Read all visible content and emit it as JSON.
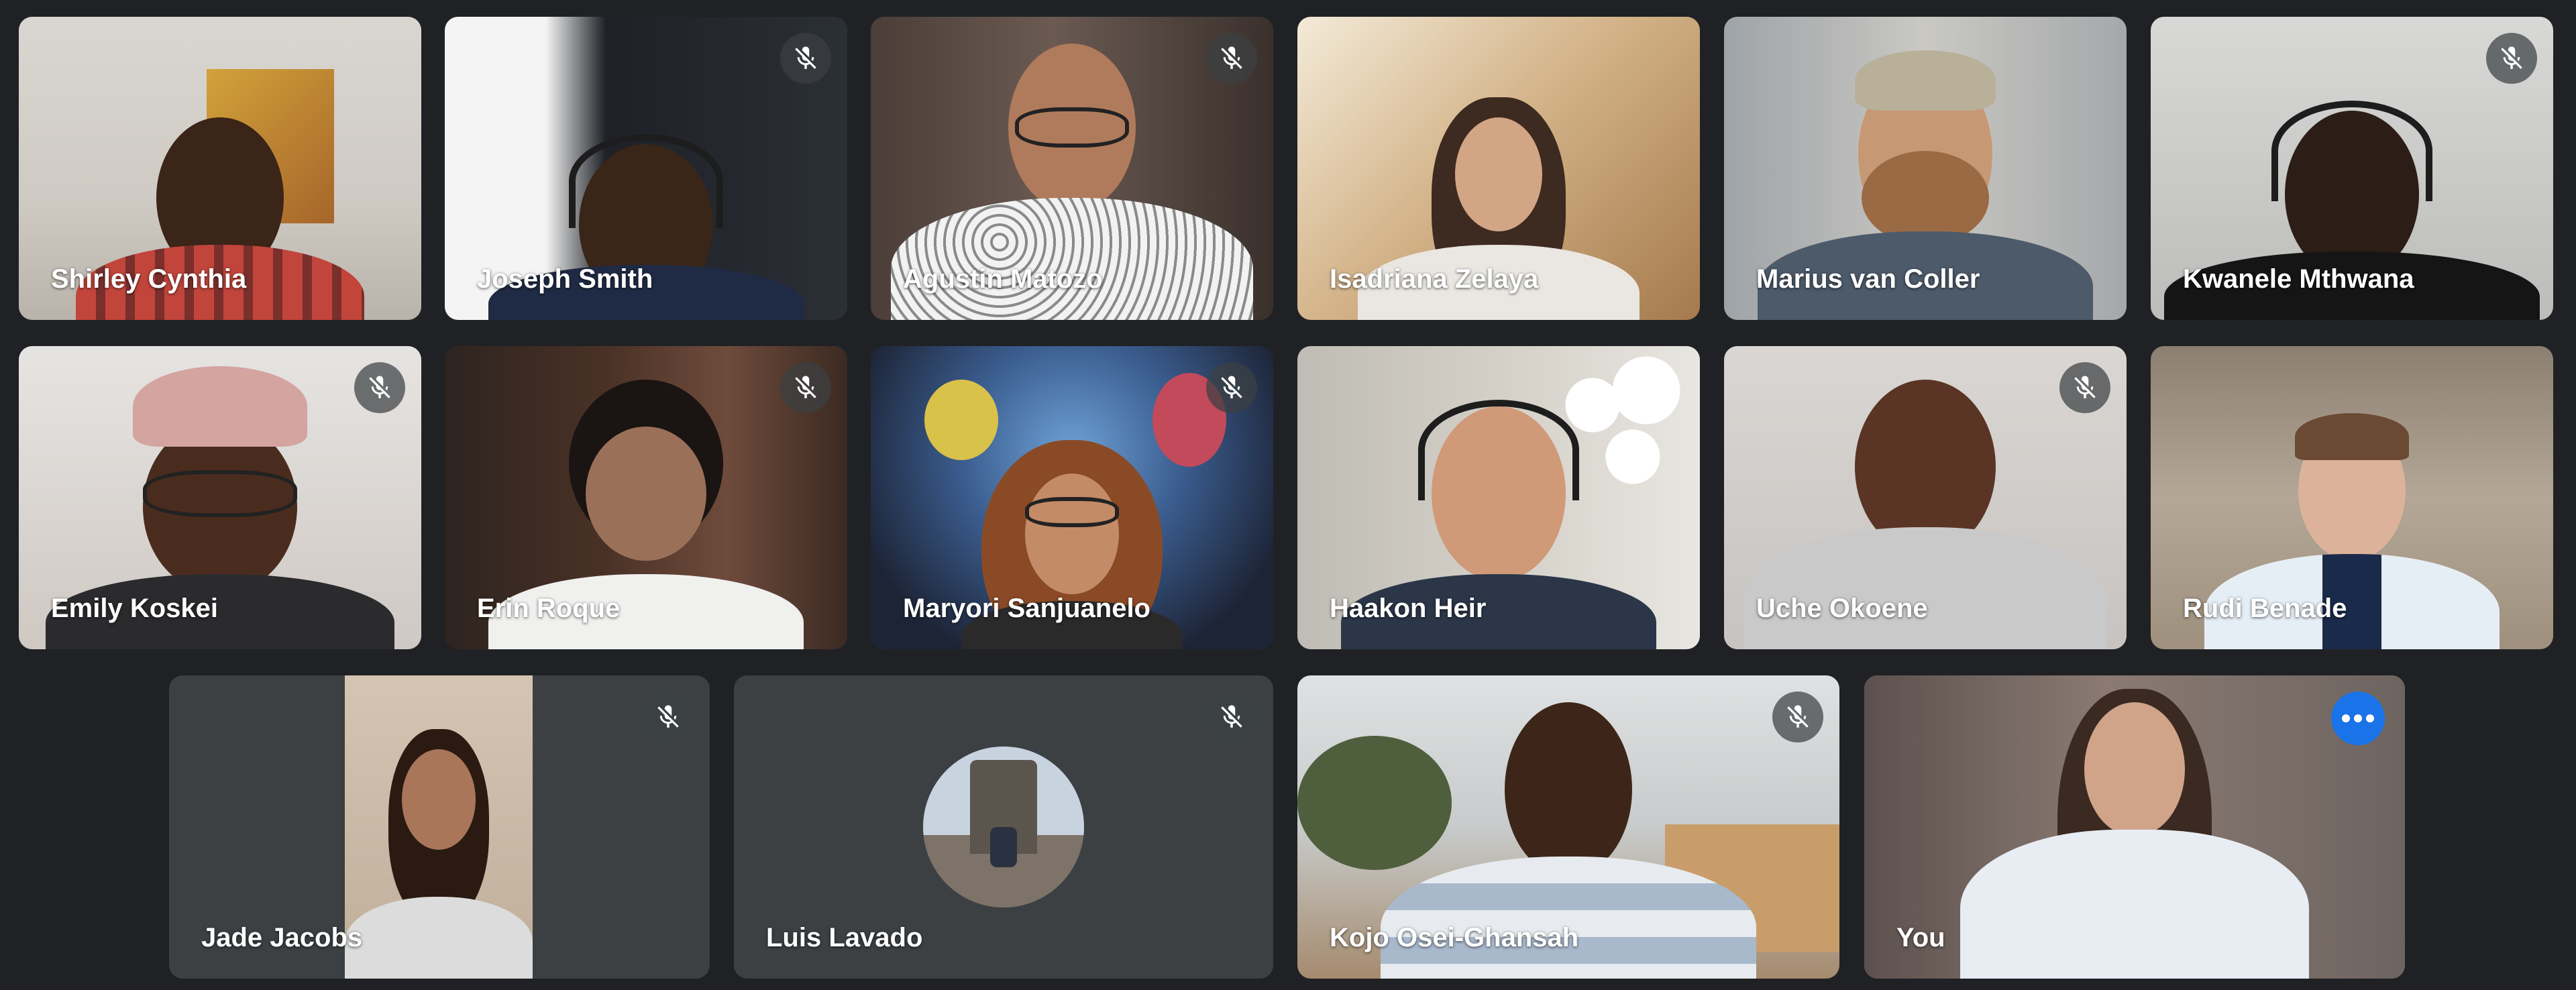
{
  "participants": [
    {
      "name": "Shirley Cynthia",
      "muted": false
    },
    {
      "name": "Joseph Smith",
      "muted": true
    },
    {
      "name": "Agustin Matozo",
      "muted": true
    },
    {
      "name": "Isadriana Zelaya",
      "muted": false
    },
    {
      "name": "Marius van Coller",
      "muted": false
    },
    {
      "name": "Kwanele Mthwana",
      "muted": true
    },
    {
      "name": "Emily Koskei",
      "muted": true
    },
    {
      "name": "Erin Roque",
      "muted": true
    },
    {
      "name": "Maryori Sanjuanelo",
      "muted": true
    },
    {
      "name": "Haakon Heir",
      "muted": false
    },
    {
      "name": "Uche Okoene",
      "muted": true
    },
    {
      "name": "Rudi Benade",
      "muted": false
    },
    {
      "name": "Jade Jacobs",
      "muted": true
    },
    {
      "name": "Luis Lavado",
      "muted": true
    },
    {
      "name": "Kojo Osei-Ghansah",
      "muted": true
    },
    {
      "name": "You",
      "muted": false
    }
  ],
  "icons": {
    "mute": "mic-off-icon",
    "more": "more-options-icon"
  },
  "colors": {
    "background": "#202124",
    "tile": "#3c4043",
    "active_border": "#669df6",
    "more_button": "#1a73e8"
  }
}
